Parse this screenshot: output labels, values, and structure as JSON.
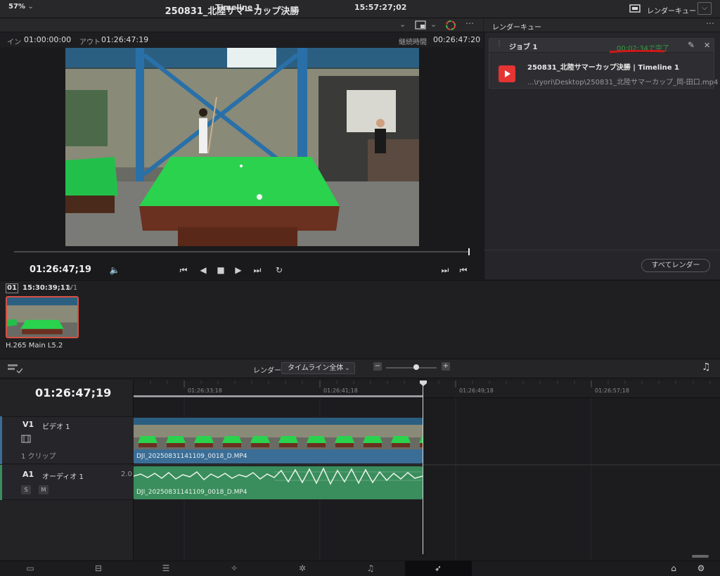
{
  "titlebar": {
    "title": "250831_北陸サマーカップ決勝",
    "render_queue_label": "レンダーキュー"
  },
  "viewer": {
    "zoom": "57%",
    "timeline_name": "Timeline 1",
    "timecode_top": "15:57:27;02",
    "in_label": "イン",
    "in_value": "01:00:00:00",
    "out_label": "アウト",
    "out_value": "01:26:47:19",
    "duration_label": "継続時間",
    "duration_value": "00:26:47:20",
    "current_timecode": "01:26:47;19"
  },
  "render_queue": {
    "title": "レンダーキュー",
    "job": {
      "name": "ジョブ 1",
      "status": "00:02:34で完了",
      "title": "250831_北陸サマーカップ決勝 | Timeline 1",
      "path": "...\\ryori\\Desktop\\250831_北陸サマーカップ_岡-田口.mp4"
    },
    "render_all_label": "すべてレンダー"
  },
  "clips": {
    "number": "01",
    "timecode": "15:30:39;11",
    "track": "V1",
    "codec": "H.265 Main L5.2"
  },
  "timeline_toolbar": {
    "render_label": "レンダー",
    "render_select": "タイムライン全体"
  },
  "timeline": {
    "timecode": "01:26:47;19",
    "ruler_labels": [
      "01:26:33;18",
      "01:26:41;18",
      "01:26:49;18",
      "01:26:57;18"
    ],
    "v1": {
      "id": "V1",
      "name": "ビデオ 1",
      "clip_count": "1 クリップ",
      "clip_name": "DJI_20250831141109_0018_D.MP4"
    },
    "a1": {
      "id": "A1",
      "name": "オーディオ 1",
      "channels": "2.0",
      "solo": "S",
      "mute": "M",
      "clip_name": "DJI_20250831141109_0018_D.MP4"
    }
  },
  "colors": {
    "accent_red": "#e43434",
    "status_green": "#2e9e3e",
    "video_clip": "#3b6e96",
    "audio_clip": "#3a8d5c"
  },
  "icons": {
    "nav": [
      "media-icon",
      "cut-icon",
      "edit-icon",
      "fusion-icon",
      "color-icon",
      "fairlight-icon",
      "deliver-icon",
      "home-icon",
      "settings-icon"
    ]
  }
}
